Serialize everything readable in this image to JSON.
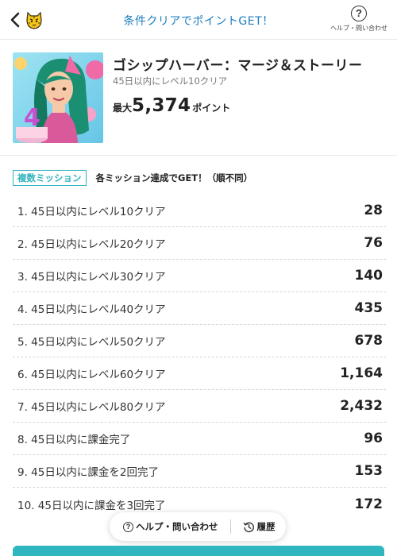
{
  "header": {
    "title": "条件クリアでポイントGET！",
    "help_label": "ヘルプ・問い合わせ",
    "help_glyph": "?"
  },
  "offer": {
    "title": "ゴシップハーバー：マージ＆ストーリー",
    "subtitle": "45日以内にレベル10クリア",
    "points_prefix": "最大",
    "points_value": "5,374",
    "points_suffix": "ポイント"
  },
  "mission": {
    "badge": "複数ミッション",
    "note": "各ミッション達成でGET！（順不同）"
  },
  "missions": [
    {
      "label": "1. 45日以内にレベル10クリア",
      "points": "28"
    },
    {
      "label": "2. 45日以内にレベル20クリア",
      "points": "76"
    },
    {
      "label": "3. 45日以内にレベル30クリア",
      "points": "140"
    },
    {
      "label": "4. 45日以内にレベル40クリア",
      "points": "435"
    },
    {
      "label": "5. 45日以内にレベル50クリア",
      "points": "678"
    },
    {
      "label": "6. 45日以内にレベル60クリア",
      "points": "1,164"
    },
    {
      "label": "7. 45日以内にレベル80クリア",
      "points": "2,432"
    },
    {
      "label": "8. 45日以内に課金完了",
      "points": "96"
    },
    {
      "label": "9. 45日以内に課金を2回完了",
      "points": "153"
    },
    {
      "label": "10. 45日以内に課金を3回完了",
      "points": "172"
    }
  ],
  "footer": {
    "help_label": "ヘルプ・問い合わせ",
    "history_label": "履歴"
  },
  "colors": {
    "accent_blue": "#1b7dbf",
    "accent_teal": "#30b6bf"
  }
}
